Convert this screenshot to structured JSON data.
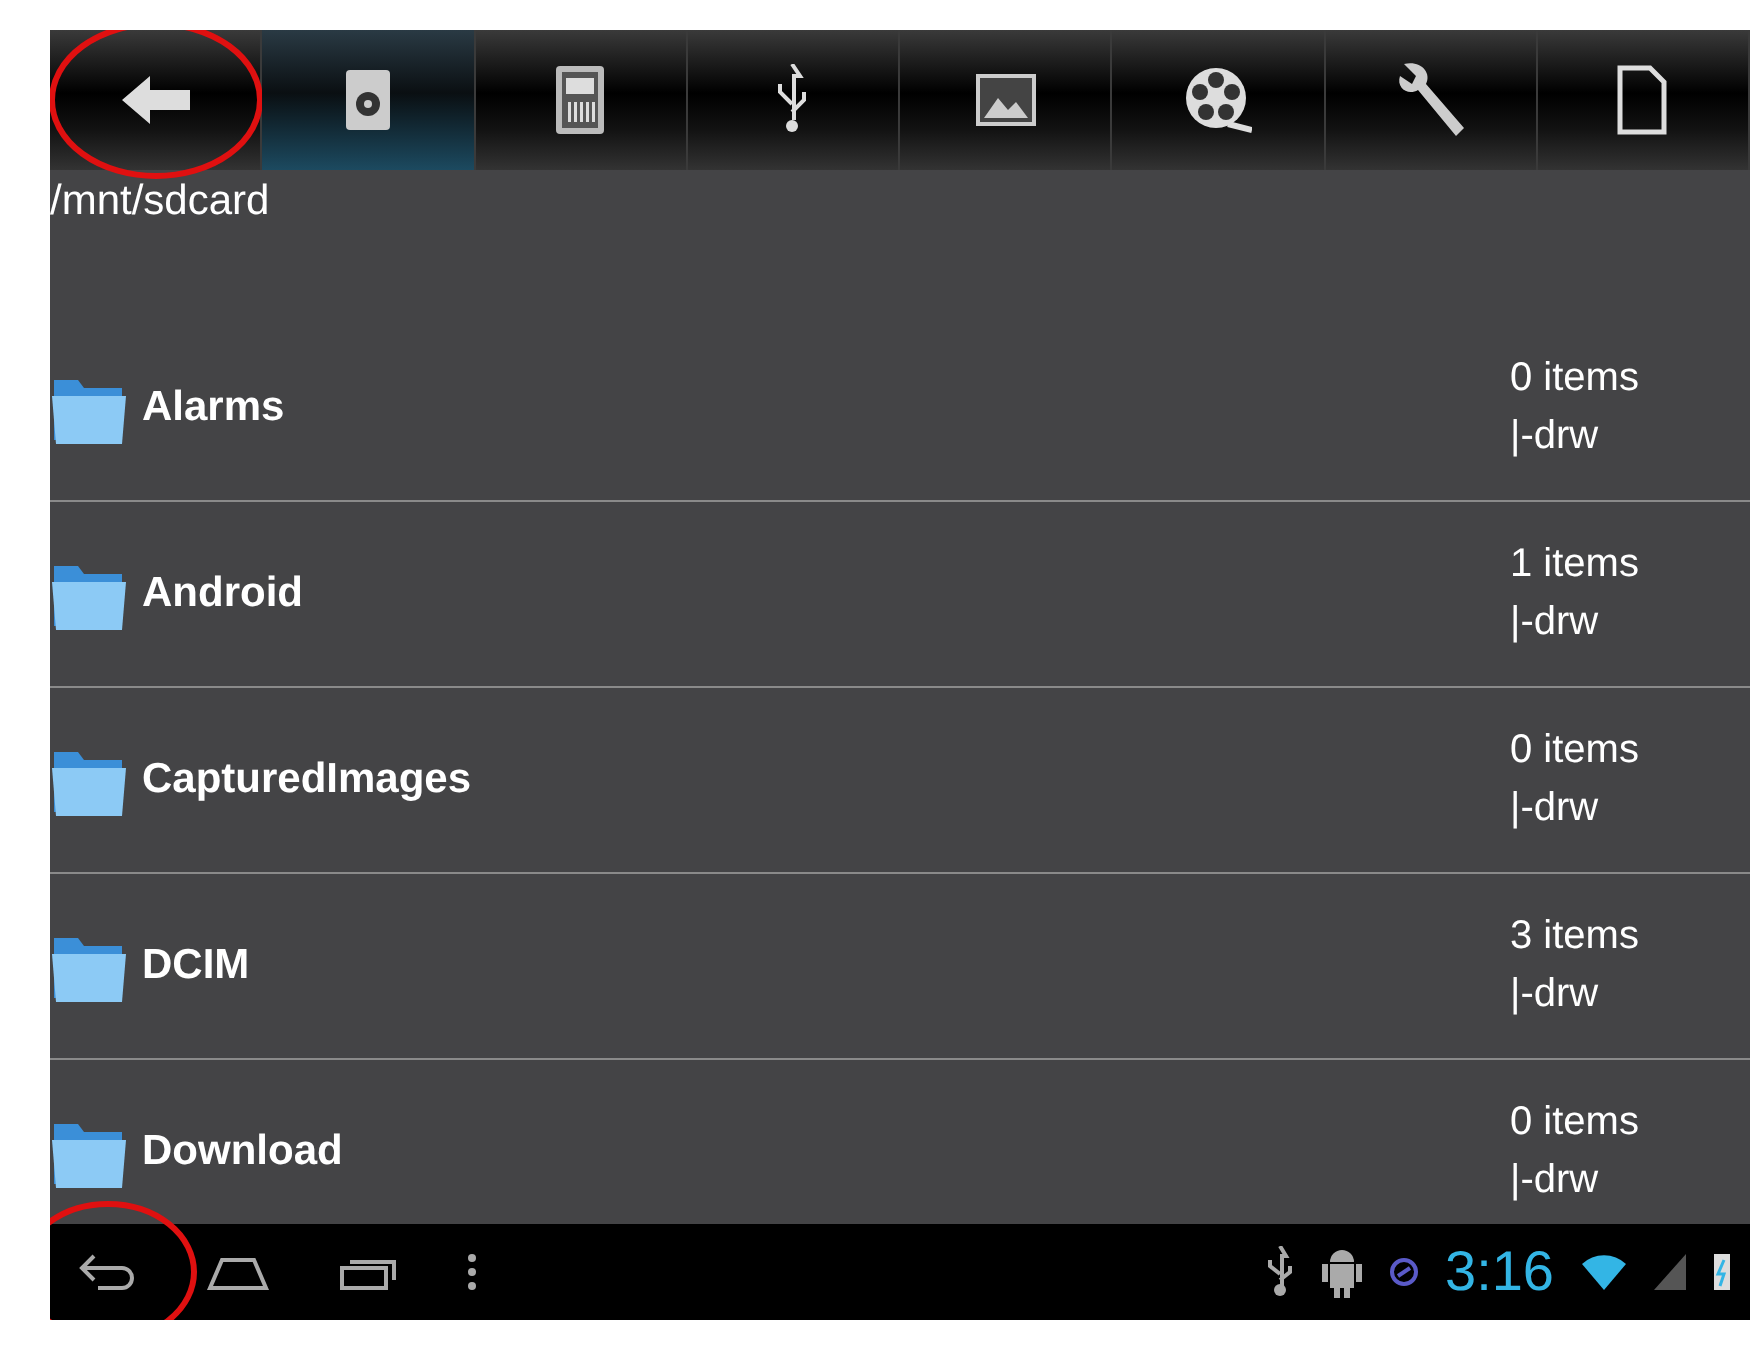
{
  "toolbar": {
    "buttons": [
      {
        "kind": "back",
        "selected": false,
        "circled": true
      },
      {
        "kind": "disc",
        "selected": true,
        "circled": false
      },
      {
        "kind": "sdcard",
        "selected": false,
        "circled": false
      },
      {
        "kind": "usb",
        "selected": false,
        "circled": false
      },
      {
        "kind": "picture",
        "selected": false,
        "circled": false
      },
      {
        "kind": "film",
        "selected": false,
        "circled": false
      },
      {
        "kind": "wrench",
        "selected": false,
        "circled": false
      },
      {
        "kind": "file",
        "selected": false,
        "circled": false
      }
    ]
  },
  "path": "/mnt/sdcard",
  "folders": [
    {
      "name": "Alarms",
      "count": "0 items",
      "permissions": "|-drw"
    },
    {
      "name": "Android",
      "count": "1 items",
      "permissions": "|-drw"
    },
    {
      "name": "CapturedImages",
      "count": "0 items",
      "permissions": "|-drw"
    },
    {
      "name": "DCIM",
      "count": "3 items",
      "permissions": "|-drw"
    },
    {
      "name": "Download",
      "count": "0 items",
      "permissions": "|-drw"
    }
  ],
  "nav_buttons": [
    {
      "kind": "back",
      "circled": true
    },
    {
      "kind": "home",
      "circled": false
    },
    {
      "kind": "recent",
      "circled": false
    },
    {
      "kind": "menu",
      "circled": false
    }
  ],
  "status_bar": {
    "time": "3:16"
  }
}
